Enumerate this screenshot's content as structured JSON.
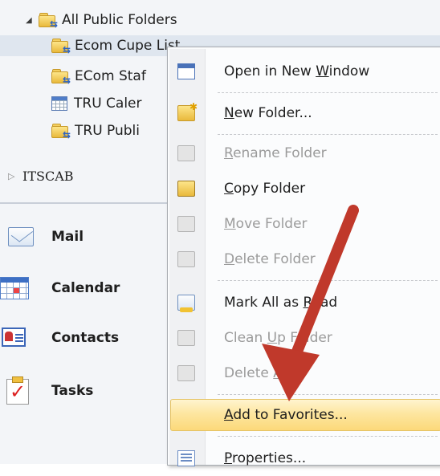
{
  "nav": {
    "tree": {
      "root_label": "All Public Folders",
      "children": [
        {
          "label": "Ecom Cupe List",
          "selected": true
        },
        {
          "label": "ECom Staf"
        },
        {
          "label": "TRU Caler"
        },
        {
          "label": "TRU Publi"
        }
      ],
      "account_label": "ITSCAB"
    },
    "buttons": [
      {
        "label": "Mail",
        "icon": "mail-icon"
      },
      {
        "label": "Calendar",
        "icon": "calendar-icon"
      },
      {
        "label": "Contacts",
        "icon": "contacts-icon"
      },
      {
        "label": "Tasks",
        "icon": "tasks-icon"
      }
    ]
  },
  "context_menu": {
    "items": [
      {
        "pre": "Open in New ",
        "u": "W",
        "post": "indow",
        "enabled": true,
        "icon": "open-new-window-icon"
      },
      {
        "pre": "",
        "u": "N",
        "post": "ew Folder...",
        "enabled": true,
        "icon": "new-folder-icon"
      },
      {
        "pre": "",
        "u": "R",
        "post": "ename Folder",
        "enabled": false,
        "icon": "rename-folder-icon"
      },
      {
        "pre": "",
        "u": "C",
        "post": "opy Folder",
        "enabled": true,
        "icon": "copy-folder-icon"
      },
      {
        "pre": "",
        "u": "M",
        "post": "ove Folder",
        "enabled": false,
        "icon": "move-folder-icon"
      },
      {
        "pre": "",
        "u": "D",
        "post": "elete Folder",
        "enabled": false,
        "icon": "delete-folder-icon"
      },
      {
        "pre": "Mark All as ",
        "u": "R",
        "post": "ead",
        "enabled": true,
        "icon": "mark-all-read-icon"
      },
      {
        "pre": "Clean ",
        "u": "U",
        "post": "p Folder",
        "enabled": false,
        "icon": "clean-up-folder-icon"
      },
      {
        "pre": "Delete ",
        "u": "A",
        "post": "ll",
        "enabled": false,
        "icon": "delete-all-icon"
      },
      {
        "pre": "",
        "u": "A",
        "post": "dd to Favorites...",
        "enabled": true,
        "highlighted": true,
        "icon": "add-to-favorites-icon"
      },
      {
        "pre": "",
        "u": "P",
        "post": "roperties...",
        "enabled": true,
        "icon": "properties-icon"
      }
    ]
  },
  "annotation": {
    "color": "#c0392b",
    "icon": "red-arrow-icon"
  }
}
